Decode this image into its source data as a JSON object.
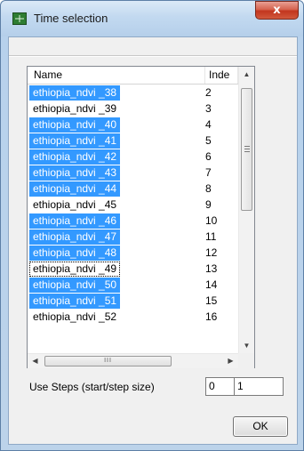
{
  "window": {
    "title": "Time selection",
    "close_glyph": "x",
    "icon": "app-grid-icon"
  },
  "list": {
    "columns": [
      "Name",
      "Inde"
    ],
    "rows": [
      {
        "name": "ethiopia_ndvi _38",
        "index": "2",
        "selected": true
      },
      {
        "name": "ethiopia_ndvi _39",
        "index": "3",
        "selected": false
      },
      {
        "name": "ethiopia_ndvi _40",
        "index": "4",
        "selected": true
      },
      {
        "name": "ethiopia_ndvi _41",
        "index": "5",
        "selected": true
      },
      {
        "name": "ethiopia_ndvi _42",
        "index": "6",
        "selected": true
      },
      {
        "name": "ethiopia_ndvi _43",
        "index": "7",
        "selected": true
      },
      {
        "name": "ethiopia_ndvi _44",
        "index": "8",
        "selected": true
      },
      {
        "name": "ethiopia_ndvi _45",
        "index": "9",
        "selected": false
      },
      {
        "name": "ethiopia_ndvi _46",
        "index": "10",
        "selected": true
      },
      {
        "name": "ethiopia_ndvi _47",
        "index": "11",
        "selected": true
      },
      {
        "name": "ethiopia_ndvi _48",
        "index": "12",
        "selected": true
      },
      {
        "name": "ethiopia_ndvi _49",
        "index": "13",
        "selected": false,
        "focused": true
      },
      {
        "name": "ethiopia_ndvi _50",
        "index": "14",
        "selected": true
      },
      {
        "name": "ethiopia_ndvi _51",
        "index": "15",
        "selected": true
      },
      {
        "name": "ethiopia_ndvi _52",
        "index": "16",
        "selected": false
      }
    ],
    "hscroll_thumb_glyph": "III",
    "selection_color": "#3399ff"
  },
  "steps": {
    "label": "Use Steps (start/step size)",
    "start_value": "0",
    "step_size_value": "1"
  },
  "ok_label": "OK"
}
